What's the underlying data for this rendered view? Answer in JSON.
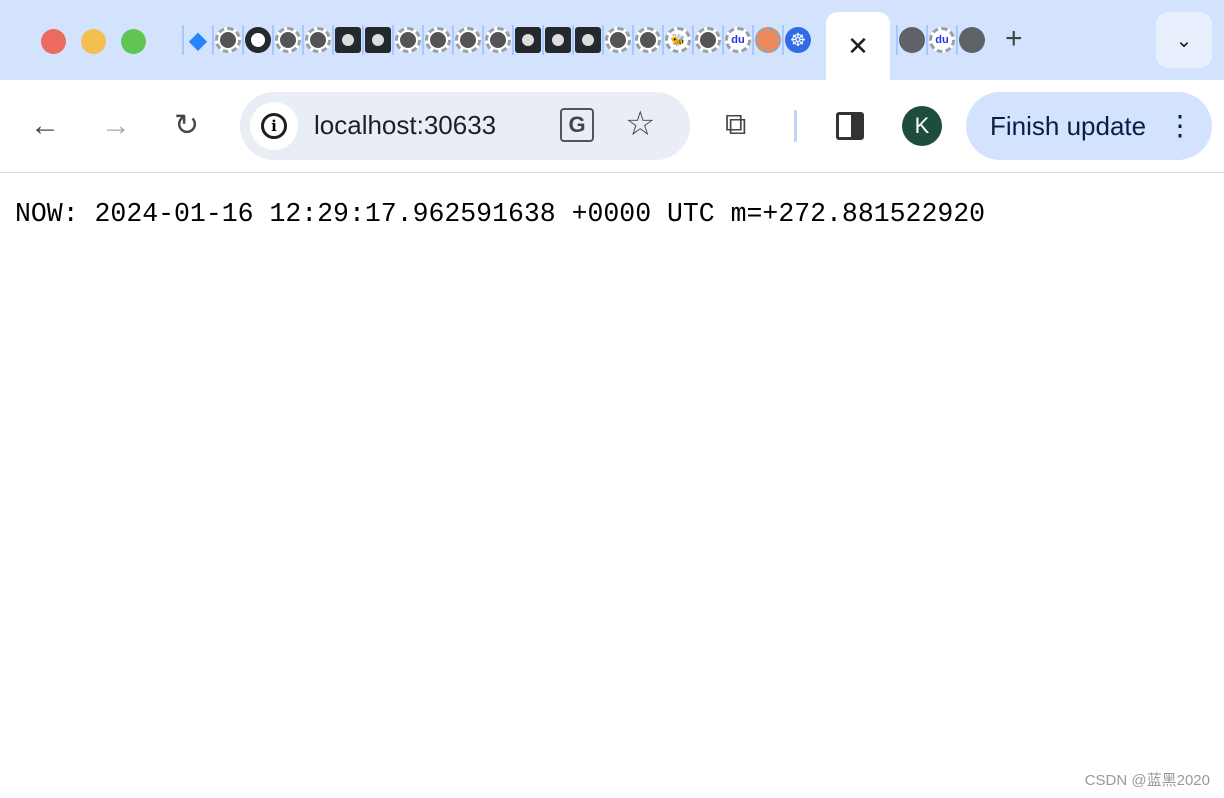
{
  "window": {
    "traffic_lights": {
      "close": "#ed6a5e",
      "minimize": "#f5bf4f",
      "maximize": "#61c554"
    }
  },
  "tabs": {
    "favicons": [
      "jira",
      "github",
      "github-large",
      "github",
      "github",
      "github-dark",
      "github-dark",
      "github",
      "github",
      "github",
      "github",
      "github-dark",
      "github-dark",
      "github-dark",
      "github",
      "github",
      "bee",
      "github",
      "baidu",
      "orange-hex",
      "kubernetes"
    ],
    "active_close": "✕",
    "after": [
      "globe",
      "baidu",
      "globe"
    ],
    "new_tab": "+",
    "tab_search": "⌄"
  },
  "toolbar": {
    "back": "←",
    "forward": "→",
    "reload": "↻",
    "url": "localhost:30633",
    "avatar_letter": "K",
    "finish_update": "Finish update"
  },
  "page": {
    "text": "NOW: 2024-01-16 12:29:17.962591638 +0000 UTC m=+272.881522920"
  },
  "watermark": "CSDN @蓝黑2020"
}
